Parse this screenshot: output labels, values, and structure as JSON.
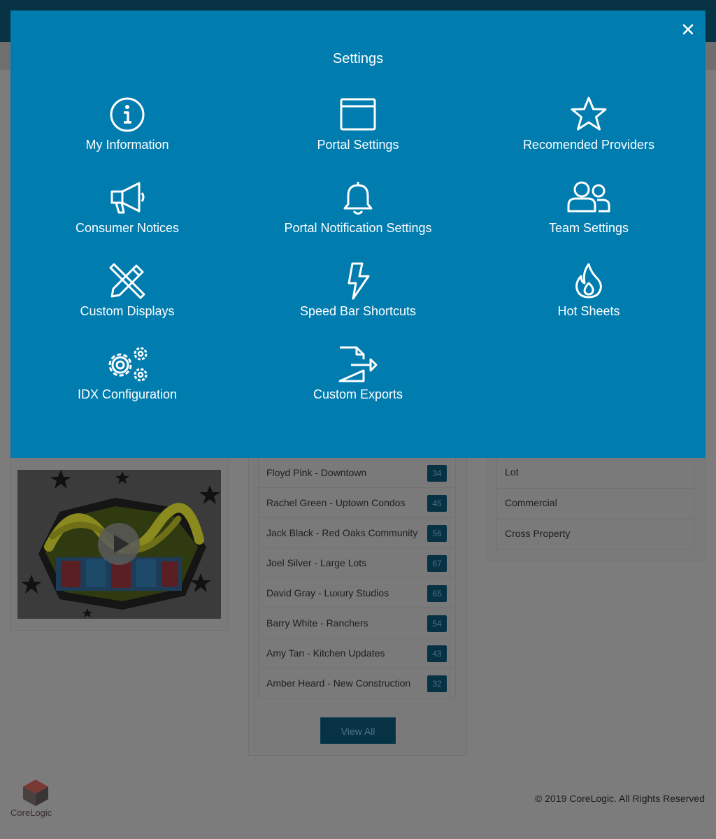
{
  "modal": {
    "title": "Settings",
    "close_icon": "close-icon",
    "tiles": [
      {
        "label": "My Information",
        "icon": "info-icon"
      },
      {
        "label": "Portal Settings",
        "icon": "browser-window-icon"
      },
      {
        "label": "Recomended Providers",
        "icon": "star-icon"
      },
      {
        "label": "Consumer Notices",
        "icon": "megaphone-icon"
      },
      {
        "label": "Portal Notification Settings",
        "icon": "bell-icon"
      },
      {
        "label": "Team Settings",
        "icon": "users-icon"
      },
      {
        "label": "Custom Displays",
        "icon": "pencil-ruler-icon"
      },
      {
        "label": "Speed Bar Shortcuts",
        "icon": "lightning-icon"
      },
      {
        "label": "Hot Sheets",
        "icon": "flame-icon"
      },
      {
        "label": "IDX Configuration",
        "icon": "gears-icon"
      },
      {
        "label": "Custom Exports",
        "icon": "file-export-icon"
      }
    ]
  },
  "hotsheets": {
    "items": [
      {
        "label": "Floyd Pink - Downtown",
        "count": "34"
      },
      {
        "label": "Rachel Green - Uptown Condos",
        "count": "45"
      },
      {
        "label": "Jack Black - Red Oaks Community",
        "count": "56"
      },
      {
        "label": "Joel Silver - Large Lots",
        "count": "67"
      },
      {
        "label": "David Gray - Luxury Studios",
        "count": "65"
      },
      {
        "label": "Barry White - Ranchers",
        "count": "54"
      },
      {
        "label": "Amy Tan - Kitchen Updates",
        "count": "43"
      },
      {
        "label": "Amber Heard - New Construction",
        "count": "32"
      }
    ],
    "view_all": "View All"
  },
  "property_types": {
    "items": [
      "Lot",
      "Commercial",
      "Cross Property"
    ]
  },
  "video": {
    "thumbnail_icon": "play-icon"
  },
  "footer": {
    "logo_core": "Core",
    "logo_logic": "Logic",
    "copyright": "© 2019 CoreLogic. All Rights Reserved"
  },
  "colors": {
    "modal_bg": "#007caf",
    "header_bg": "#063244",
    "overlay_bg": "#7c7c7c"
  }
}
